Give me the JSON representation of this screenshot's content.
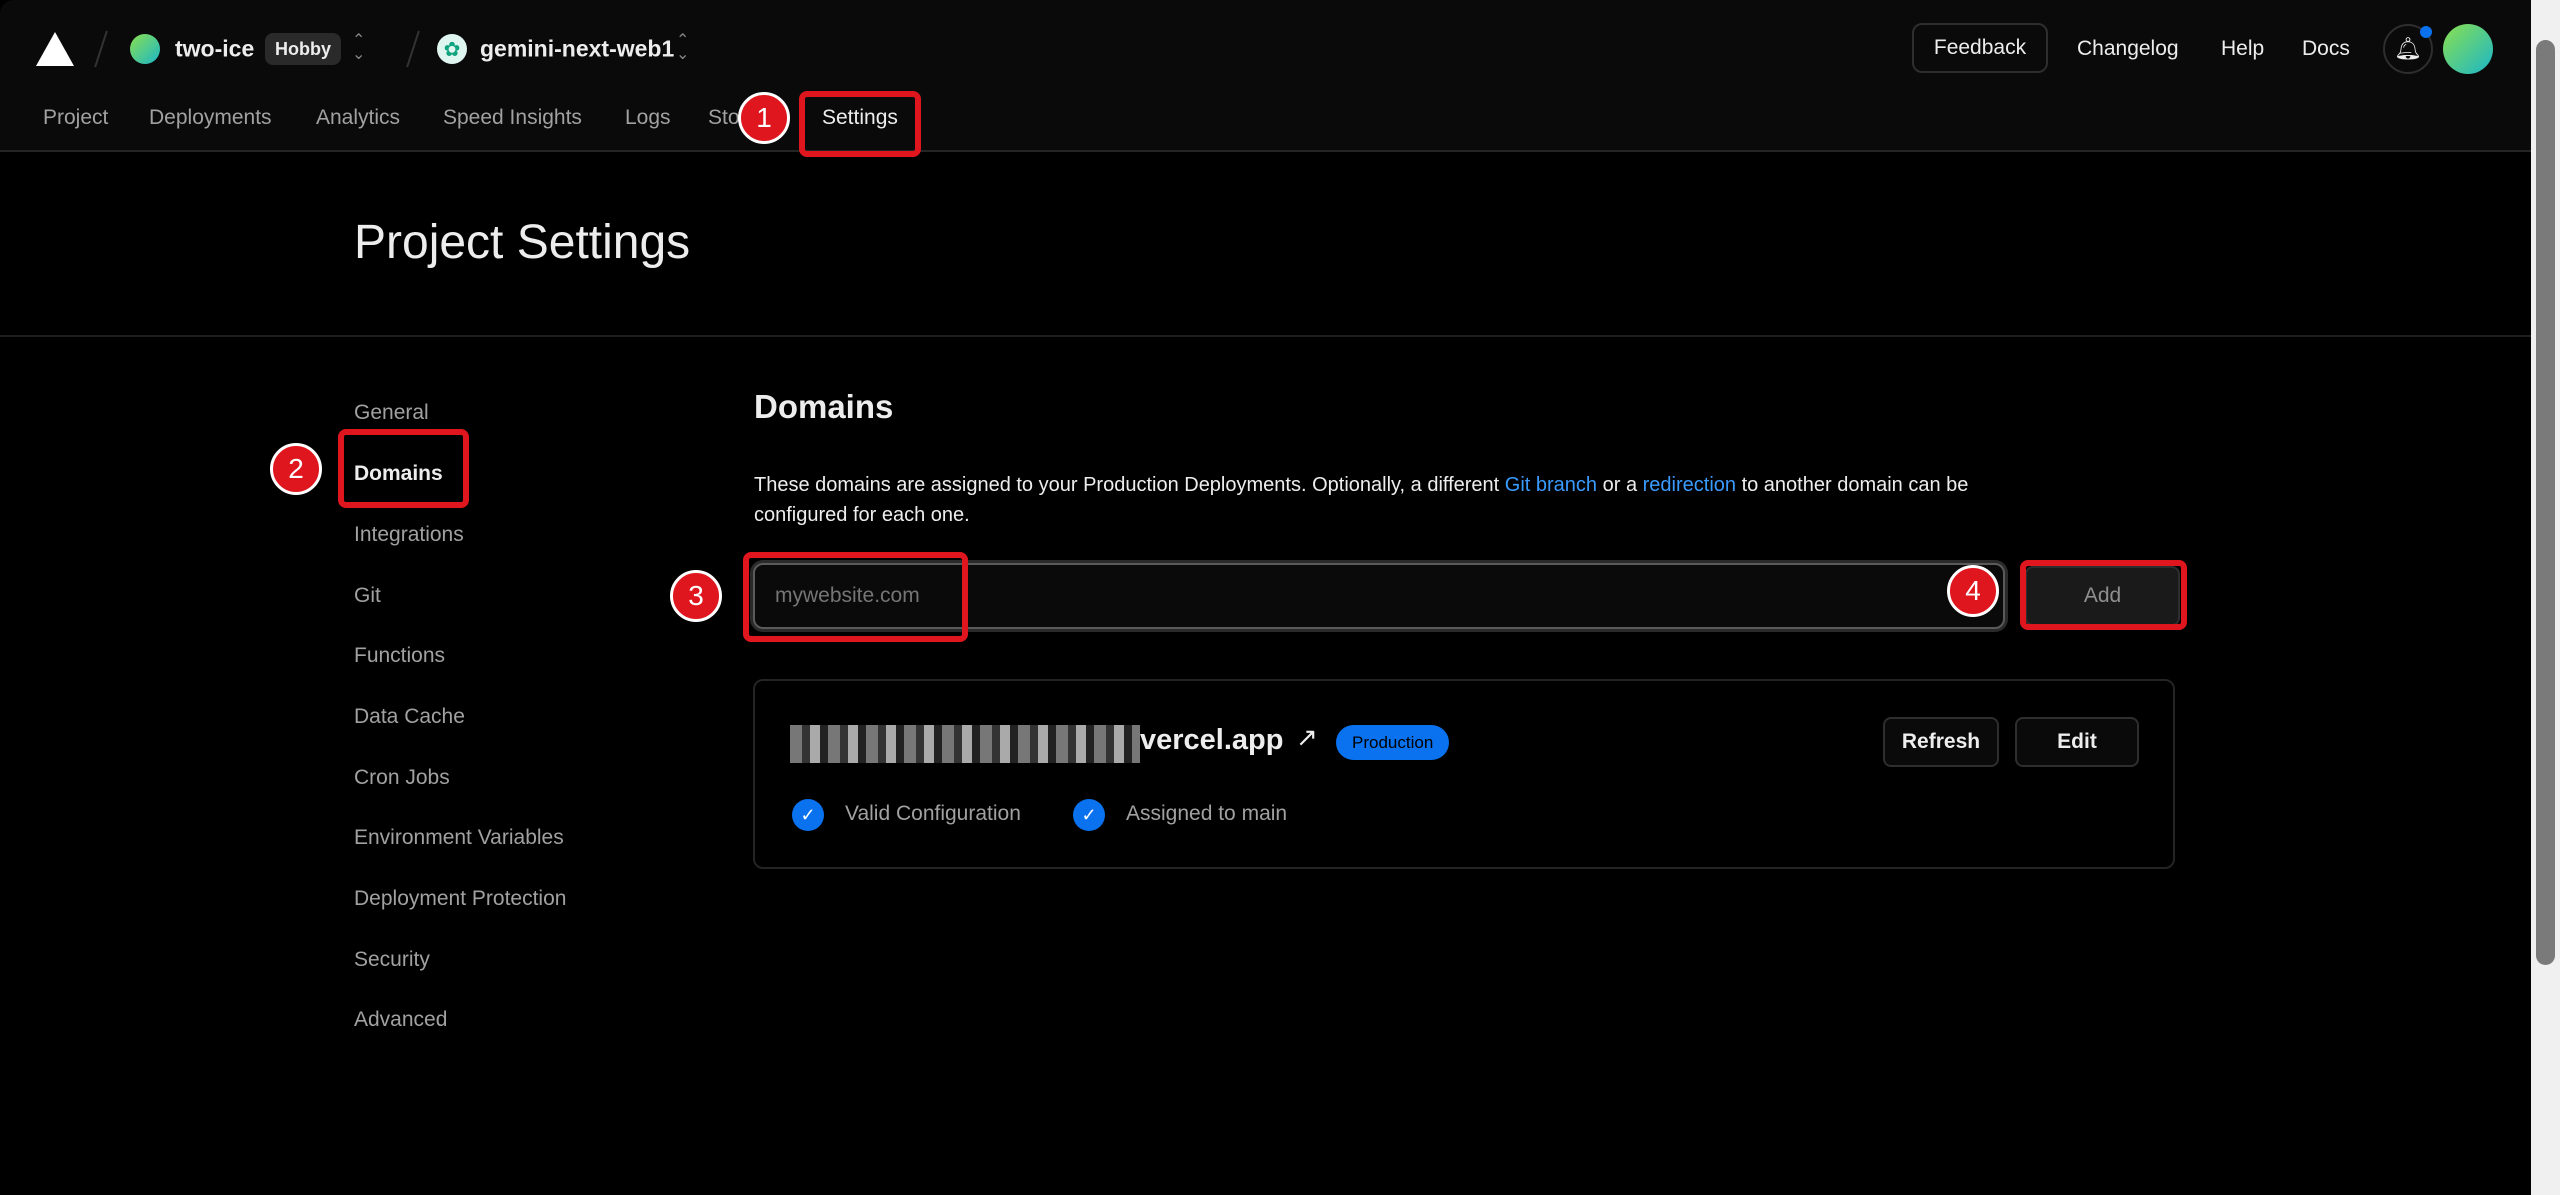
{
  "header": {
    "team": "two-ice",
    "plan_badge": "Hobby",
    "project": "gemini-next-web1",
    "feedback": "Feedback",
    "links": [
      "Changelog",
      "Help",
      "Docs"
    ]
  },
  "nav": [
    "Project",
    "Deployments",
    "Analytics",
    "Speed Insights",
    "Logs",
    "Sto",
    "Settings"
  ],
  "page_title": "Project Settings",
  "sidebar": [
    "General",
    "Domains",
    "Integrations",
    "Git",
    "Functions",
    "Data Cache",
    "Cron Jobs",
    "Environment Variables",
    "Deployment Protection",
    "Security",
    "Advanced"
  ],
  "domains": {
    "heading": "Domains",
    "desc_1": "These domains are assigned to your Production Deployments. Optionally, a different ",
    "link_git": "Git branch",
    "desc_2": " or a ",
    "link_redirect": "redirection",
    "desc_3": " to another domain can be",
    "desc_4": "configured for each one.",
    "input_placeholder": "mywebsite.com",
    "add": "Add",
    "domain_suffix": "vercel.app",
    "badge": "Production",
    "refresh": "Refresh",
    "edit": "Edit",
    "status_1": "Valid Configuration",
    "status_2": "Assigned to main"
  },
  "annotations": [
    "1",
    "2",
    "3",
    "4"
  ],
  "colors": {
    "accent": "#0a72ef",
    "annotation": "#e0161e",
    "link": "#3a9bff"
  }
}
